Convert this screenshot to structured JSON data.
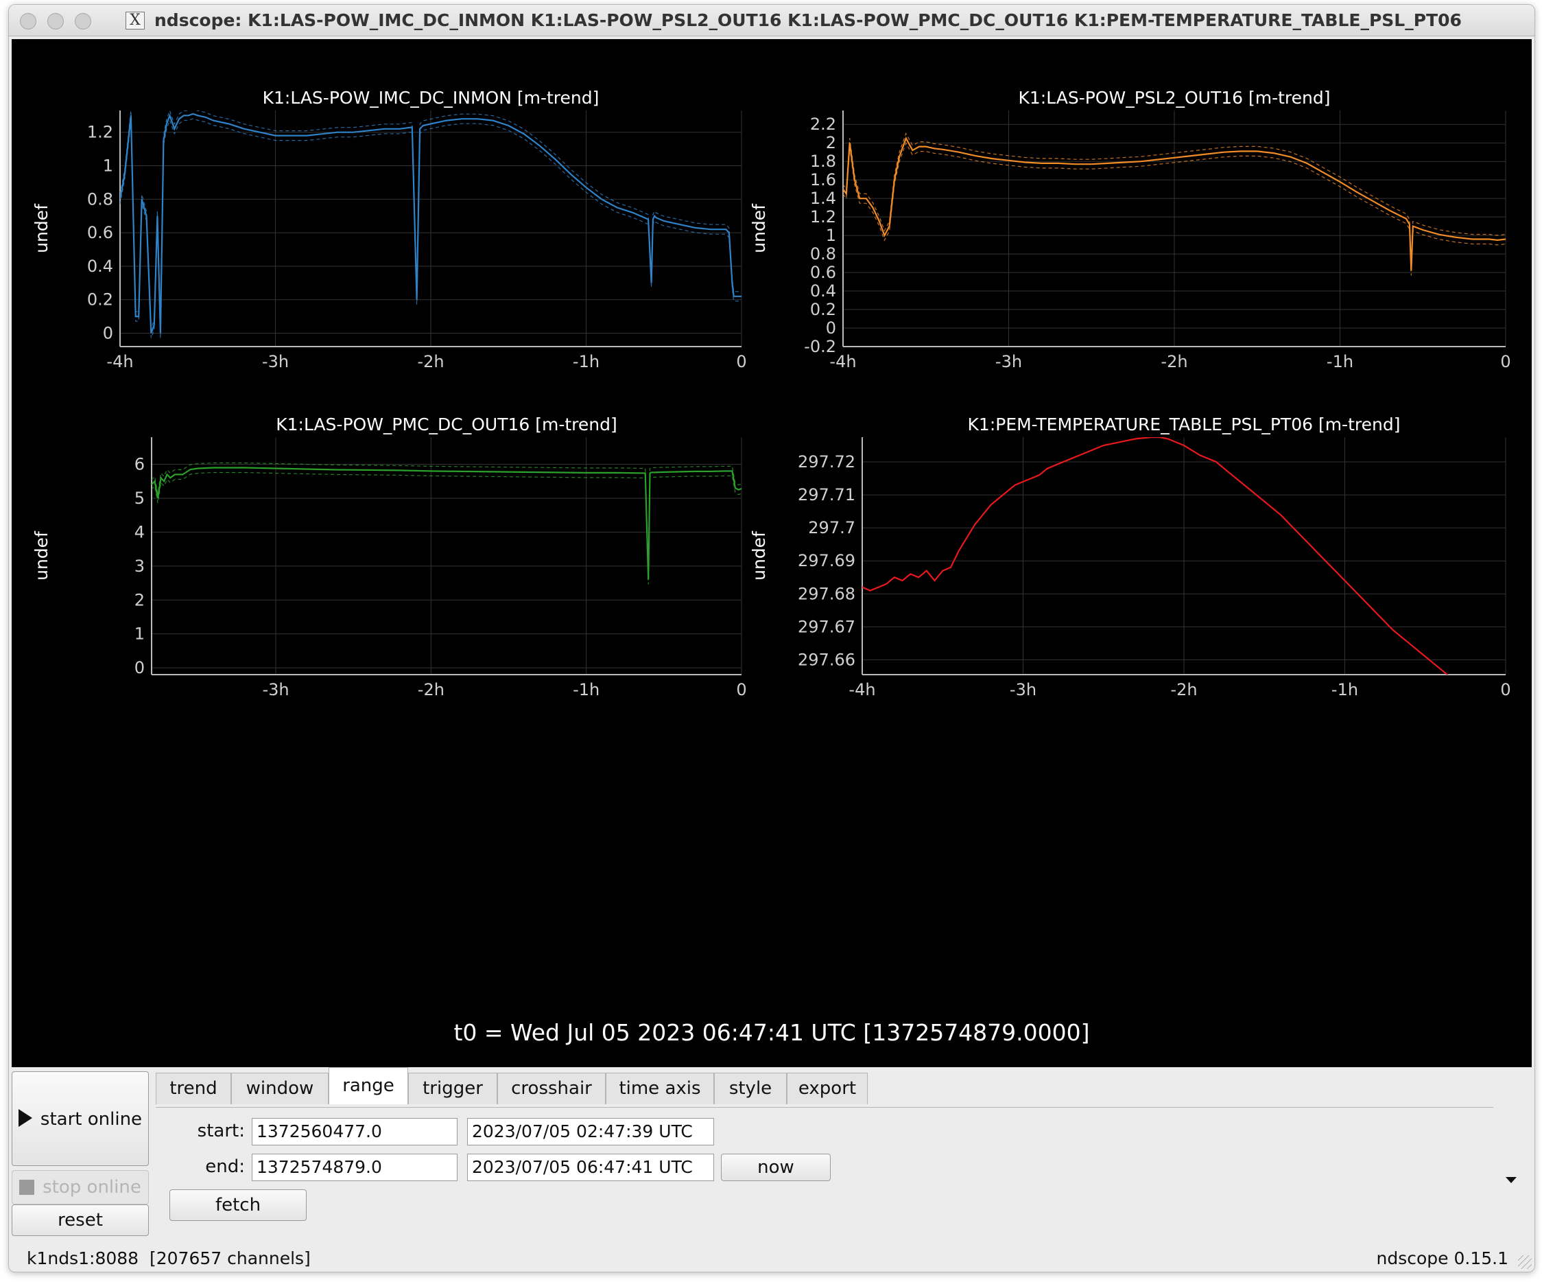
{
  "window": {
    "title": "ndscope: K1:LAS-POW_IMC_DC_INMON K1:LAS-POW_PSL2_OUT16 K1:LAS-POW_PMC_DC_OUT16 K1:PEM-TEMPERATURE_TABLE_PSL_PT06",
    "title_icon": "x11-icon"
  },
  "chart_data": [
    {
      "type": "line",
      "title": "K1:LAS-POW_IMC_DC_INMON [m-trend]",
      "ylabel": "undef",
      "xlim": [
        -4,
        0
      ],
      "ylim": [
        -0.08,
        1.33
      ],
      "xticks": [
        -4,
        -3,
        -2,
        -1,
        0
      ],
      "xtick_labels": [
        "-4h",
        "-3h",
        "-2h",
        "-1h",
        "0"
      ],
      "yticks": [
        0,
        0.2,
        0.4,
        0.6,
        0.8,
        1,
        1.2
      ],
      "ytick_labels": [
        "0",
        "0.2",
        "0.4",
        "0.6",
        "0.8",
        "1",
        "1.2"
      ],
      "grid": true,
      "color": "#2f83c9",
      "series": [
        {
          "x": [
            -4.0,
            -3.97,
            -3.93,
            -3.9,
            -3.88,
            -3.86,
            -3.83,
            -3.8,
            -3.78,
            -3.76,
            -3.74,
            -3.72,
            -3.7,
            -3.68,
            -3.65,
            -3.62,
            -3.59,
            -3.56,
            -3.53,
            -3.5,
            -3.45,
            -3.4,
            -3.3,
            -3.2,
            -3.1,
            -3.0,
            -2.9,
            -2.8,
            -2.7,
            -2.6,
            -2.5,
            -2.4,
            -2.3,
            -2.2,
            -2.12,
            -2.09,
            -2.07,
            -2.05,
            -2.0,
            -1.9,
            -1.8,
            -1.7,
            -1.6,
            -1.5,
            -1.4,
            -1.3,
            -1.2,
            -1.1,
            -1.0,
            -0.9,
            -0.8,
            -0.7,
            -0.6,
            -0.58,
            -0.57,
            -0.56,
            -0.55,
            -0.5,
            -0.4,
            -0.3,
            -0.2,
            -0.1,
            -0.08,
            -0.06,
            -0.05,
            -0.03,
            0.0
          ],
          "y": [
            0.8,
            0.95,
            1.3,
            0.1,
            0.1,
            0.8,
            0.7,
            0.0,
            0.05,
            0.7,
            0.0,
            1.15,
            1.25,
            1.3,
            1.22,
            1.28,
            1.3,
            1.3,
            1.31,
            1.3,
            1.29,
            1.27,
            1.25,
            1.22,
            1.2,
            1.18,
            1.18,
            1.18,
            1.19,
            1.2,
            1.2,
            1.21,
            1.22,
            1.22,
            1.23,
            0.2,
            1.22,
            1.24,
            1.25,
            1.27,
            1.28,
            1.28,
            1.27,
            1.24,
            1.19,
            1.12,
            1.04,
            0.95,
            0.87,
            0.8,
            0.75,
            0.72,
            0.68,
            0.3,
            0.68,
            0.7,
            0.69,
            0.67,
            0.65,
            0.63,
            0.62,
            0.62,
            0.6,
            0.3,
            0.22,
            0.22,
            0.22
          ]
        }
      ]
    },
    {
      "type": "line",
      "title": "K1:LAS-POW_PSL2_OUT16 [m-trend]",
      "ylabel": "undef",
      "xlim": [
        -4,
        0
      ],
      "ylim": [
        -0.2,
        2.35
      ],
      "xticks": [
        -4,
        -3,
        -2,
        -1,
        0
      ],
      "xtick_labels": [
        "-4h",
        "-3h",
        "-2h",
        "-1h",
        "0"
      ],
      "yticks": [
        -0.2,
        0,
        0.2,
        0.4,
        0.6,
        0.8,
        1,
        1.2,
        1.4,
        1.6,
        1.8,
        2,
        2.2
      ],
      "ytick_labels": [
        "-0.2",
        "0",
        "0.2",
        "0.4",
        "0.6",
        "0.8",
        "1",
        "1.2",
        "1.4",
        "1.6",
        "1.8",
        "2",
        "2.2"
      ],
      "grid": true,
      "color": "#f28c28",
      "series": [
        {
          "x": [
            -4.0,
            -3.98,
            -3.96,
            -3.93,
            -3.9,
            -3.86,
            -3.82,
            -3.78,
            -3.75,
            -3.72,
            -3.69,
            -3.66,
            -3.62,
            -3.58,
            -3.54,
            -3.5,
            -3.45,
            -3.4,
            -3.3,
            -3.2,
            -3.1,
            -3.0,
            -2.9,
            -2.8,
            -2.7,
            -2.6,
            -2.5,
            -2.4,
            -2.3,
            -2.2,
            -2.1,
            -2.0,
            -1.9,
            -1.8,
            -1.7,
            -1.6,
            -1.5,
            -1.4,
            -1.3,
            -1.2,
            -1.1,
            -1.0,
            -0.9,
            -0.8,
            -0.7,
            -0.6,
            -0.58,
            -0.57,
            -0.56,
            -0.5,
            -0.4,
            -0.3,
            -0.2,
            -0.1,
            -0.05,
            0.0
          ],
          "y": [
            1.5,
            1.45,
            2.0,
            1.6,
            1.4,
            1.4,
            1.3,
            1.15,
            1.0,
            1.1,
            1.6,
            1.85,
            2.05,
            1.92,
            1.96,
            1.96,
            1.94,
            1.93,
            1.9,
            1.86,
            1.83,
            1.81,
            1.79,
            1.78,
            1.78,
            1.77,
            1.77,
            1.78,
            1.79,
            1.8,
            1.82,
            1.84,
            1.86,
            1.88,
            1.9,
            1.91,
            1.91,
            1.89,
            1.85,
            1.78,
            1.68,
            1.58,
            1.47,
            1.37,
            1.27,
            1.18,
            1.12,
            0.62,
            1.1,
            1.06,
            1.01,
            0.98,
            0.96,
            0.96,
            0.95,
            0.96
          ]
        }
      ]
    },
    {
      "type": "line",
      "title": "K1:LAS-POW_PMC_DC_OUT16 [m-trend]",
      "ylabel": "undef",
      "xlim": [
        -3.8,
        0
      ],
      "ylim": [
        -0.2,
        6.8
      ],
      "xticks": [
        -3,
        -2,
        -1,
        0
      ],
      "xtick_labels": [
        "-3h",
        "-2h",
        "-1h",
        "0"
      ],
      "yticks": [
        0,
        1,
        2,
        3,
        4,
        5,
        6
      ],
      "ytick_labels": [
        "0",
        "1",
        "2",
        "3",
        "4",
        "5",
        "6"
      ],
      "grid": true,
      "color": "#2ca02c",
      "series": [
        {
          "x": [
            -3.8,
            -3.78,
            -3.76,
            -3.74,
            -3.72,
            -3.7,
            -3.68,
            -3.65,
            -3.6,
            -3.55,
            -3.5,
            -3.4,
            -3.2,
            -3.0,
            -2.8,
            -2.6,
            -2.4,
            -2.2,
            -2.0,
            -1.8,
            -1.6,
            -1.4,
            -1.2,
            -1.0,
            -0.8,
            -0.62,
            -0.6,
            -0.59,
            -0.58,
            -0.56,
            -0.5,
            -0.4,
            -0.3,
            -0.2,
            -0.1,
            -0.06,
            -0.04,
            -0.02,
            0.0
          ],
          "y": [
            5.4,
            5.5,
            5.0,
            5.6,
            5.5,
            5.7,
            5.6,
            5.7,
            5.7,
            5.85,
            5.88,
            5.9,
            5.9,
            5.88,
            5.86,
            5.84,
            5.83,
            5.82,
            5.8,
            5.79,
            5.78,
            5.77,
            5.76,
            5.75,
            5.75,
            5.74,
            2.6,
            5.74,
            5.76,
            5.76,
            5.77,
            5.78,
            5.79,
            5.79,
            5.8,
            5.8,
            5.3,
            5.25,
            5.28
          ]
        }
      ]
    },
    {
      "type": "line",
      "title": "K1:PEM-TEMPERATURE_TABLE_PSL_PT06 [m-trend]",
      "ylabel": "undef",
      "xlim": [
        -4,
        0
      ],
      "ylim": [
        297.6555,
        297.7275
      ],
      "xticks": [
        -4,
        -3,
        -2,
        -1,
        0
      ],
      "xtick_labels": [
        "-4h",
        "-3h",
        "-2h",
        "-1h",
        "0"
      ],
      "yticks": [
        297.66,
        297.67,
        297.68,
        297.69,
        297.7,
        297.71,
        297.72
      ],
      "ytick_labels": [
        "297.66",
        "297.67",
        "297.68",
        "297.69",
        "297.7",
        "297.71",
        "297.72"
      ],
      "grid": true,
      "color": "#e8191c",
      "series": [
        {
          "x": [
            -4.0,
            -3.95,
            -3.9,
            -3.85,
            -3.8,
            -3.75,
            -3.7,
            -3.65,
            -3.6,
            -3.55,
            -3.5,
            -3.45,
            -3.4,
            -3.35,
            -3.3,
            -3.25,
            -3.2,
            -3.15,
            -3.1,
            -3.05,
            -3.0,
            -2.95,
            -2.9,
            -2.85,
            -2.8,
            -2.7,
            -2.6,
            -2.5,
            -2.4,
            -2.3,
            -2.2,
            -2.15,
            -2.1,
            -2.0,
            -1.9,
            -1.8,
            -1.7,
            -1.6,
            -1.5,
            -1.4,
            -1.3,
            -1.2,
            -1.1,
            -1.0,
            -0.9,
            -0.8,
            -0.7,
            -0.6,
            -0.5,
            -0.4,
            -0.35
          ],
          "y": [
            297.682,
            297.681,
            297.682,
            297.683,
            297.685,
            297.684,
            297.686,
            297.685,
            297.687,
            297.684,
            297.687,
            297.688,
            297.693,
            297.697,
            297.701,
            297.704,
            297.707,
            297.709,
            297.711,
            297.713,
            297.714,
            297.715,
            297.716,
            297.718,
            297.719,
            297.721,
            297.723,
            297.725,
            297.726,
            297.727,
            297.7275,
            297.7275,
            297.727,
            297.725,
            297.722,
            297.72,
            297.716,
            297.712,
            297.708,
            297.704,
            297.699,
            297.694,
            297.689,
            297.684,
            297.679,
            297.674,
            297.669,
            297.665,
            297.661,
            297.657,
            297.655
          ]
        }
      ]
    }
  ],
  "t0_label": "t0 = Wed Jul 05 2023 06:47:41 UTC [1372574879.0000]",
  "controls": {
    "start_online": "start online",
    "stop_online": "stop online",
    "reset": "reset",
    "tabs": [
      "trend",
      "window",
      "range",
      "trigger",
      "crosshair",
      "time axis",
      "style",
      "export"
    ],
    "active_tab": "range",
    "start_label": "start:",
    "start_gps": "1372560477.0",
    "start_utc": "2023/07/05 02:47:39 UTC",
    "end_label": "end:",
    "end_gps": "1372574879.0",
    "end_utc": "2023/07/05 06:47:41 UTC",
    "now": "now",
    "fetch": "fetch"
  },
  "status": {
    "server": "k1nds1:8088  [207657 channels]",
    "version": "ndscope 0.15.1"
  }
}
